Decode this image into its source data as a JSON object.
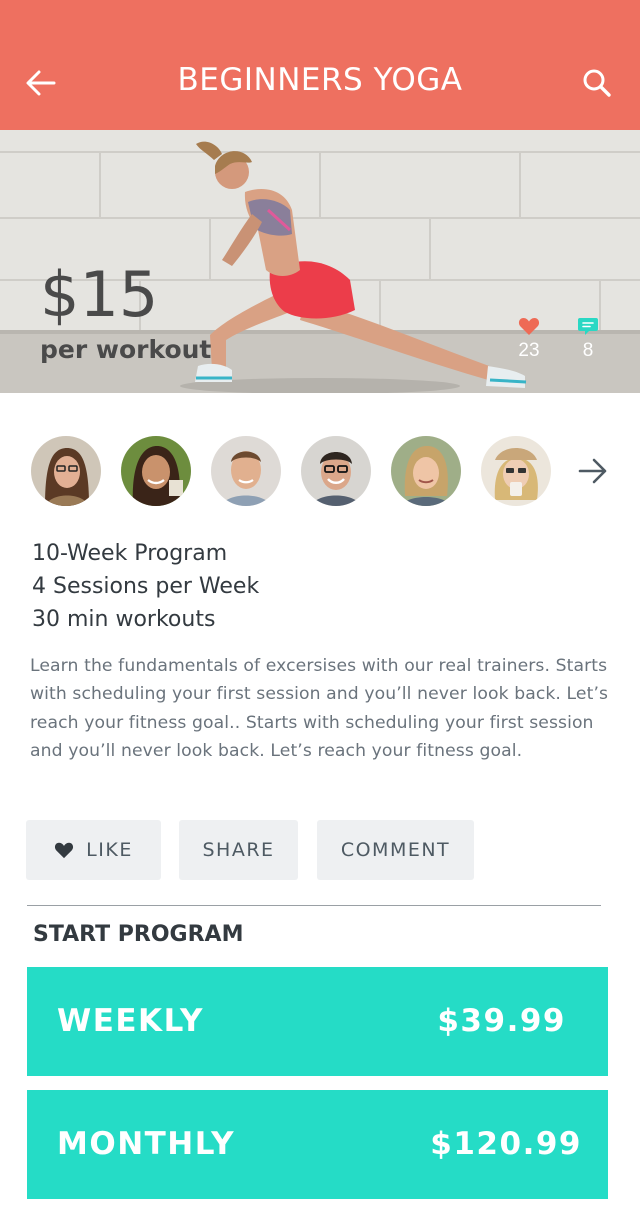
{
  "header": {
    "title": "BEGINNERS YOGA",
    "back_icon": "arrow-left-icon",
    "search_icon": "search-icon",
    "background_color": "#ee7060"
  },
  "hero": {
    "price": "$15",
    "price_unit": "per workout",
    "likes_count": "23",
    "comments_count": "8",
    "like_icon_color": "#ee6a55",
    "comment_icon_color": "#2ad8c4"
  },
  "trainers": {
    "next_icon": "arrow-right-icon"
  },
  "program": {
    "features": [
      "10-Week Program",
      "4 Sessions per Week",
      "30 min workouts"
    ],
    "description": "Learn the fundamentals of excersises with our real trainers. Starts with scheduling your first session and you’ll never look back. Let’s reach your fitness goal.. Starts with scheduling your first session and you’ll never look back. Let’s reach your fitness goal."
  },
  "actions": {
    "like_label": "LIKE",
    "share_label": "SHARE",
    "comment_label": "COMMENT"
  },
  "start_program": {
    "title": "START PROGRAM",
    "plans": [
      {
        "name": "WEEKLY",
        "price": "$39.99"
      },
      {
        "name": "MONTHLY",
        "price": "$120.99"
      }
    ],
    "accent_color": "#25dcc6"
  }
}
